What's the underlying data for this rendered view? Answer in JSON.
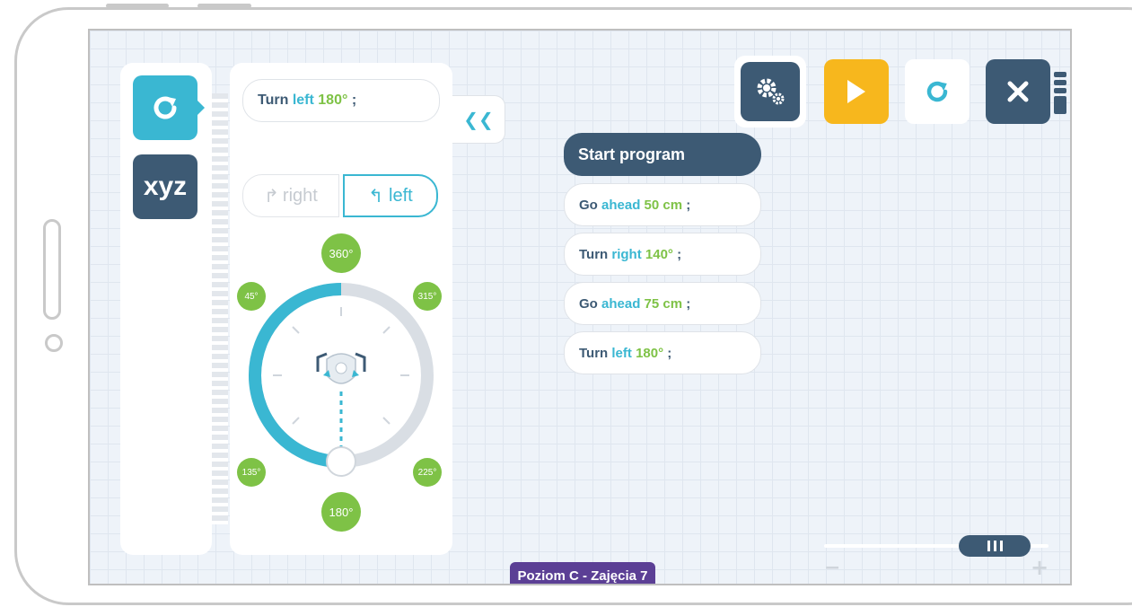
{
  "categories": [
    {
      "name": "rotate",
      "icon": "rotate-icon",
      "color": "#3ab7d2"
    },
    {
      "name": "xyz",
      "label": "xyz",
      "color": "#3d5a74"
    }
  ],
  "editor": {
    "preview": {
      "verb": "Turn",
      "keyword": "left",
      "value": "180°",
      "terminator": ";"
    },
    "direction": {
      "right_label": "right",
      "left_label": "left",
      "selected": "left"
    },
    "dial": {
      "top": "360°",
      "bottom": "180°",
      "upper_left": "45°",
      "upper_right": "315°",
      "lower_left": "135°",
      "lower_right": "225°",
      "value_degrees": 180
    }
  },
  "collapse_label": "❮❮",
  "program": {
    "start_label": "Start program",
    "commands": [
      {
        "verb": "Go",
        "keyword": "ahead",
        "value": "50 cm",
        "terminator": ";"
      },
      {
        "verb": "Turn",
        "keyword": "right",
        "value": "140°",
        "terminator": ";"
      },
      {
        "verb": "Go",
        "keyword": "ahead",
        "value": "75 cm",
        "terminator": ";"
      },
      {
        "verb": "Turn",
        "keyword": "left",
        "value": "180°",
        "terminator": ";"
      }
    ]
  },
  "toolbar": {
    "settings_icon": "gears-icon",
    "play_icon": "play-icon",
    "reset_icon": "rotate-icon",
    "close_icon": "close-icon",
    "play_color": "#f7b71d",
    "dark_color": "#3d5a74"
  },
  "zoom": {
    "minus_label": "−",
    "plus_label": "+",
    "level": 0.85
  },
  "level_label": "Poziom C - Zajęcia 7"
}
